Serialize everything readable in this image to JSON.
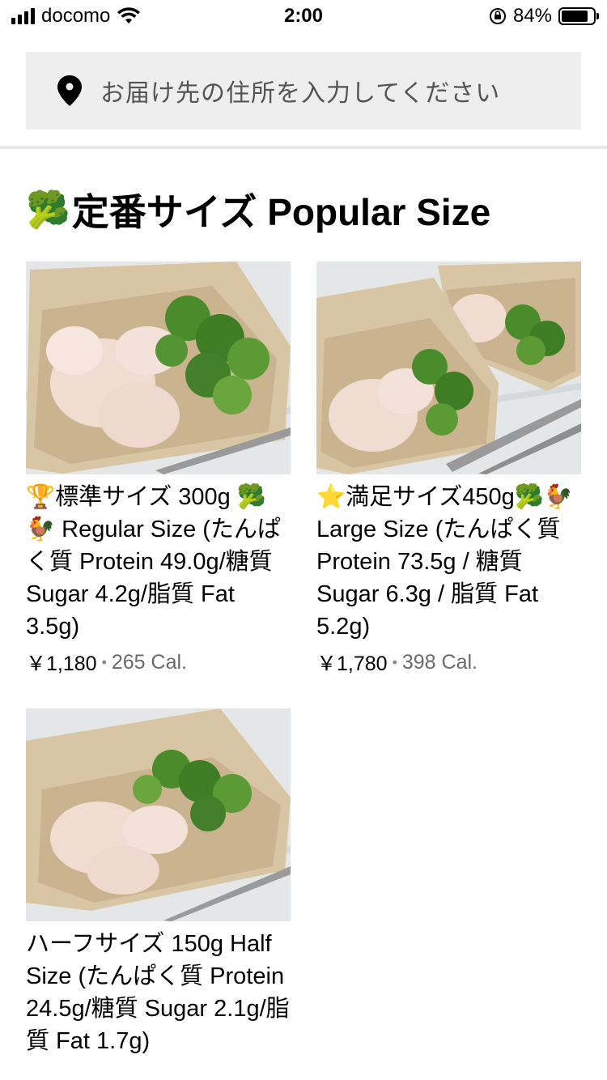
{
  "status_bar": {
    "carrier": "docomo",
    "time": "2:00",
    "battery": "84%",
    "battery_level": 0.84
  },
  "address": {
    "placeholder": "お届け先の住所を入力してください"
  },
  "section": {
    "emoji": "🥦",
    "title": "定番サイズ Popular Size"
  },
  "items": [
    {
      "title": "🏆標準サイズ 300g 🥦🐓 Regular Size (たんぱく質 Protein 49.0g/糖質 Sugar 4.2g/脂質 Fat 3.5g)",
      "price": "￥1,180",
      "calories": "265 Cal."
    },
    {
      "title": "⭐満足サイズ450g🥦🐓 Large Size (たんぱく質 Protein 73.5g / 糖質 Sugar 6.3g / 脂質 Fat 5.2g)",
      "price": "￥1,780",
      "calories": "398 Cal."
    },
    {
      "title": "ハーフサイズ 150g Half Size (たんぱく質 Protein 24.5g/糖質 Sugar 2.1g/脂質 Fat 1.7g)"
    }
  ]
}
